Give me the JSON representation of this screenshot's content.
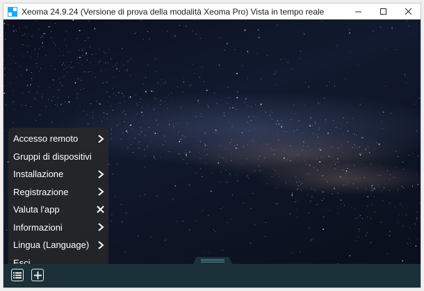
{
  "window": {
    "title": "Xeoma 24.9.24 (Versione di prova della modalità Xeoma Pro) Vista in tempo reale",
    "controls": [
      "minimize-icon",
      "maximize-icon",
      "close-icon"
    ]
  },
  "menu": {
    "items": [
      {
        "label": "Accesso remoto",
        "icon": "chevron-right-icon"
      },
      {
        "label": "Gruppi di dispositivi",
        "icon": ""
      },
      {
        "label": "Installazione",
        "icon": "chevron-right-icon"
      },
      {
        "label": "Registrazione",
        "icon": "chevron-right-icon"
      },
      {
        "label": "Valuta l'app",
        "icon": "close-icon"
      },
      {
        "label": "Informazioni",
        "icon": "chevron-right-icon"
      },
      {
        "label": "Lingua (Language)",
        "icon": "chevron-right-icon"
      },
      {
        "label": "Esci",
        "icon": ""
      }
    ]
  },
  "bottombar": {
    "buttons": [
      "list-icon",
      "plus-icon"
    ]
  },
  "colors": {
    "bottombar": "#1b3038",
    "menu_bg": "#282828",
    "accent_icon": "#1ea7ff"
  }
}
